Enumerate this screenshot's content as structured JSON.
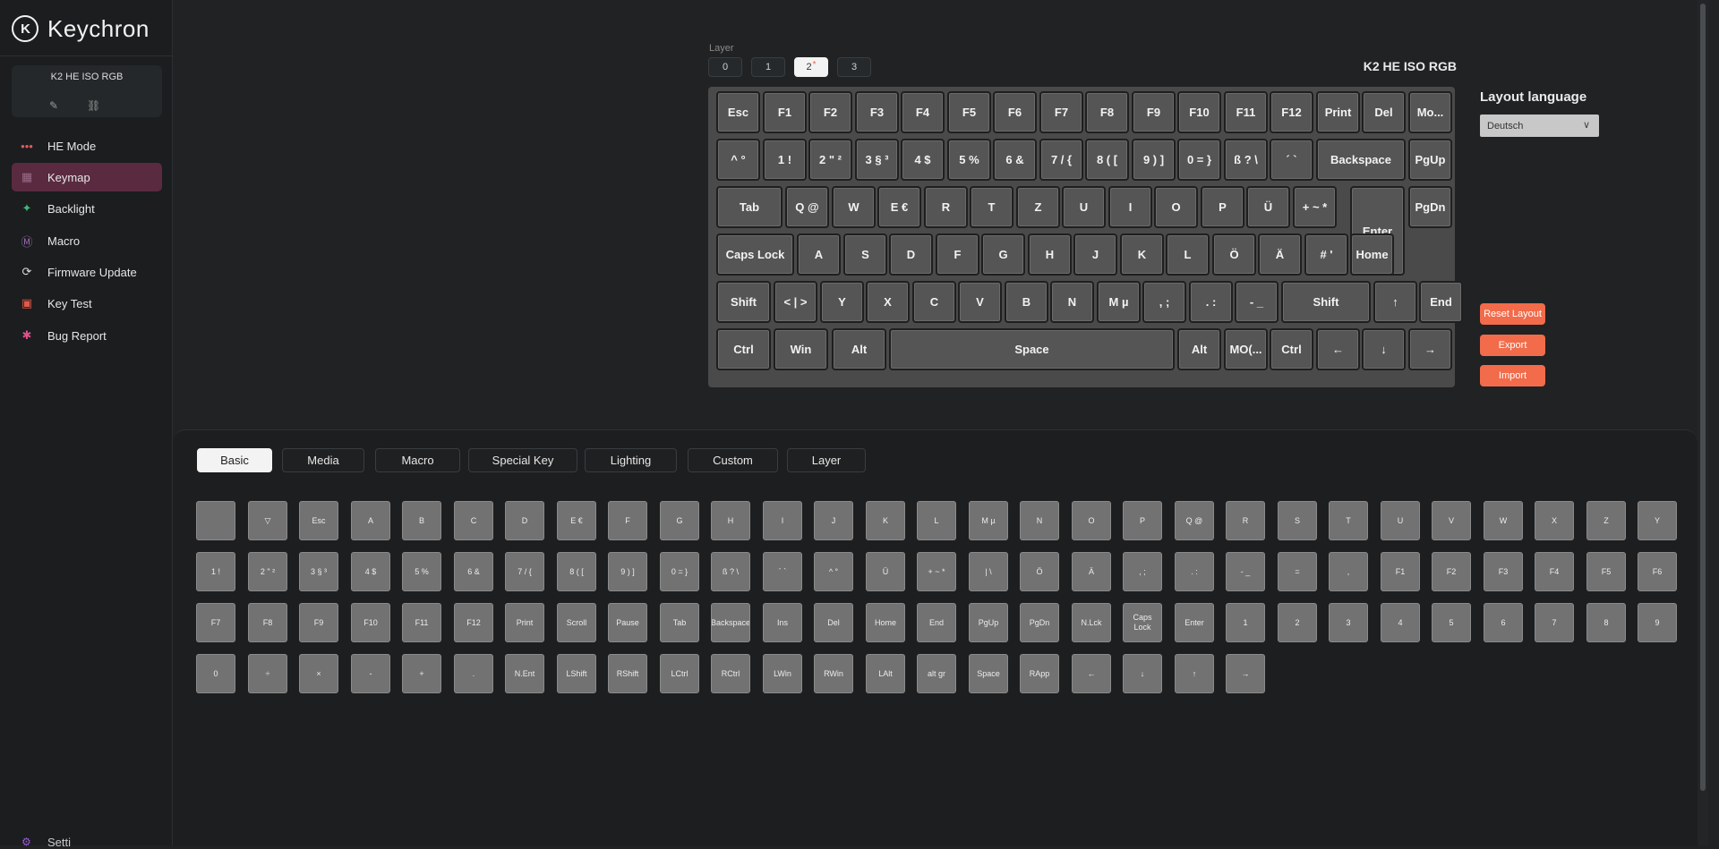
{
  "app": {
    "logo_mark": "K",
    "logo_text": "Keychron",
    "device_name": "K2 HE ISO RGB",
    "device_icons": [
      "link-icon",
      "unlink-icon"
    ]
  },
  "nav": [
    {
      "label": "HE Mode",
      "icon": "he-mode-icon",
      "glyph": "•••",
      "color": "#e05a5a",
      "active": false
    },
    {
      "label": "Keymap",
      "icon": "keyboard-icon",
      "glyph": "▦",
      "color": "#9a6b86",
      "active": true
    },
    {
      "label": "Backlight",
      "icon": "bulb-icon",
      "glyph": "✦",
      "color": "#3fb87a",
      "active": false
    },
    {
      "label": "Macro",
      "icon": "macro-icon",
      "glyph": "Ⓜ",
      "color": "#9a6bb0",
      "active": false
    },
    {
      "label": "Firmware Update",
      "icon": "update-icon",
      "glyph": "⟳",
      "color": "#dddddd",
      "active": false
    },
    {
      "label": "Key Test",
      "icon": "key-test-icon",
      "glyph": "▣",
      "color": "#e05a4a",
      "active": false
    },
    {
      "label": "Bug Report",
      "icon": "bug-icon",
      "glyph": "✱",
      "color": "#e0508a",
      "active": false
    }
  ],
  "settings_peek": "Setti",
  "layer": {
    "label": "Layer",
    "options": [
      "0",
      "1",
      "2",
      "3"
    ],
    "active_index": 2,
    "modified_marker": "*"
  },
  "keyboard_title": "K2 HE ISO RGB",
  "layout_language": {
    "label": "Layout language",
    "value": "Deutsch"
  },
  "actions": {
    "reset": "Reset Layout",
    "export": "Export",
    "import": "Import"
  },
  "keyboard_rows": [
    [
      "Esc",
      "F1",
      "F2",
      "F3",
      "F4",
      "F5",
      "F6",
      "F7",
      "F8",
      "F9",
      "F10",
      "F11",
      "F12",
      "Print",
      "Del",
      "Mo..."
    ],
    [
      "^ °",
      "1 !",
      "2 \" ²",
      "3 § ³",
      "4 $",
      "5 %",
      "6 &",
      "7 / {",
      "8 ( [",
      "9 ) ]",
      "0 = }",
      "ß ? \\",
      "´ `",
      "Backspace",
      "PgUp"
    ],
    [
      "Tab",
      "Q @",
      "W",
      "E €",
      "R",
      "T",
      "Z",
      "U",
      "I",
      "O",
      "P",
      "Ü",
      "+ ~ *",
      "Enter",
      "PgDn"
    ],
    [
      "Caps Lock",
      "A",
      "S",
      "D",
      "F",
      "G",
      "H",
      "J",
      "K",
      "L",
      "Ö",
      "Ä",
      "# '",
      "Home"
    ],
    [
      "Shift",
      "< | >",
      "Y",
      "X",
      "C",
      "V",
      "B",
      "N",
      "M µ",
      ", ;",
      ". :",
      "- _",
      "Shift",
      "↑",
      "End"
    ],
    [
      "Ctrl",
      "Win",
      "Alt",
      "Space",
      "Alt",
      "MO(...",
      "Ctrl",
      "←",
      "↓",
      "→"
    ]
  ],
  "palette_tabs": [
    {
      "label": "Basic",
      "active": true
    },
    {
      "label": "Media",
      "active": false
    },
    {
      "label": "Macro",
      "active": false
    },
    {
      "label": "Special Key",
      "active": false
    },
    {
      "label": "Lighting",
      "active": false
    },
    {
      "label": "Custom",
      "active": false
    },
    {
      "label": "Layer",
      "active": false
    }
  ],
  "palette_rows": [
    [
      "",
      "▽",
      "Esc",
      "A",
      "B",
      "C",
      "D",
      "E €",
      "F",
      "G",
      "H",
      "I",
      "J",
      "K",
      "L",
      "M µ",
      "N",
      "O",
      "P",
      "Q @",
      "R",
      "S",
      "T",
      "U",
      "V",
      "W",
      "X",
      "Z",
      "Y"
    ],
    [
      "1 !",
      "2 \" ²",
      "3 § ³",
      "4 $",
      "5 %",
      "6 &",
      "7 / {",
      "8 ( [",
      "9 ) ]",
      "0 = }",
      "ß ? \\",
      "´ `",
      "^ °",
      "Ü",
      "+ ~ *",
      "| \\",
      "Ö",
      "Ä",
      ", ;",
      ". :",
      "- _",
      "=",
      ",",
      "F1",
      "F2",
      "F3",
      "F4",
      "F5",
      "F6"
    ],
    [
      "F7",
      "F8",
      "F9",
      "F10",
      "F11",
      "F12",
      "Print",
      "Scroll",
      "Pause",
      "Tab",
      "Backspace",
      "Ins",
      "Del",
      "Home",
      "End",
      "PgUp",
      "PgDn",
      "N.Lck",
      "Caps Lock",
      "Enter",
      "1",
      "2",
      "3",
      "4",
      "5",
      "6",
      "7",
      "8",
      "9"
    ],
    [
      "0",
      "÷",
      "×",
      "-",
      "+",
      ".",
      "N.Ent",
      "LShift",
      "RShift",
      "LCtrl",
      "RCtrl",
      "LWin",
      "RWin",
      "LAlt",
      "alt gr",
      "Space",
      "RApp",
      "←",
      "↓",
      "↑",
      "→"
    ]
  ]
}
